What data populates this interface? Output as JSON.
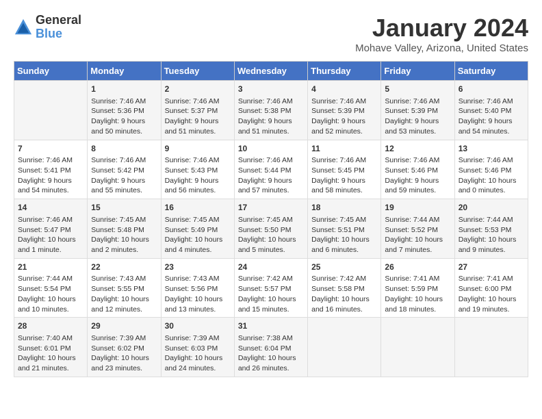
{
  "header": {
    "logo": {
      "general": "General",
      "blue": "Blue"
    },
    "title": "January 2024",
    "location": "Mohave Valley, Arizona, United States"
  },
  "calendar": {
    "headers": [
      "Sunday",
      "Monday",
      "Tuesday",
      "Wednesday",
      "Thursday",
      "Friday",
      "Saturday"
    ],
    "rows": [
      [
        {
          "day": "",
          "content": ""
        },
        {
          "day": "1",
          "content": "Sunrise: 7:46 AM\nSunset: 5:36 PM\nDaylight: 9 hours\nand 50 minutes."
        },
        {
          "day": "2",
          "content": "Sunrise: 7:46 AM\nSunset: 5:37 PM\nDaylight: 9 hours\nand 51 minutes."
        },
        {
          "day": "3",
          "content": "Sunrise: 7:46 AM\nSunset: 5:38 PM\nDaylight: 9 hours\nand 51 minutes."
        },
        {
          "day": "4",
          "content": "Sunrise: 7:46 AM\nSunset: 5:39 PM\nDaylight: 9 hours\nand 52 minutes."
        },
        {
          "day": "5",
          "content": "Sunrise: 7:46 AM\nSunset: 5:39 PM\nDaylight: 9 hours\nand 53 minutes."
        },
        {
          "day": "6",
          "content": "Sunrise: 7:46 AM\nSunset: 5:40 PM\nDaylight: 9 hours\nand 54 minutes."
        }
      ],
      [
        {
          "day": "7",
          "content": "Sunrise: 7:46 AM\nSunset: 5:41 PM\nDaylight: 9 hours\nand 54 minutes."
        },
        {
          "day": "8",
          "content": "Sunrise: 7:46 AM\nSunset: 5:42 PM\nDaylight: 9 hours\nand 55 minutes."
        },
        {
          "day": "9",
          "content": "Sunrise: 7:46 AM\nSunset: 5:43 PM\nDaylight: 9 hours\nand 56 minutes."
        },
        {
          "day": "10",
          "content": "Sunrise: 7:46 AM\nSunset: 5:44 PM\nDaylight: 9 hours\nand 57 minutes."
        },
        {
          "day": "11",
          "content": "Sunrise: 7:46 AM\nSunset: 5:45 PM\nDaylight: 9 hours\nand 58 minutes."
        },
        {
          "day": "12",
          "content": "Sunrise: 7:46 AM\nSunset: 5:46 PM\nDaylight: 9 hours\nand 59 minutes."
        },
        {
          "day": "13",
          "content": "Sunrise: 7:46 AM\nSunset: 5:46 PM\nDaylight: 10 hours\nand 0 minutes."
        }
      ],
      [
        {
          "day": "14",
          "content": "Sunrise: 7:46 AM\nSunset: 5:47 PM\nDaylight: 10 hours\nand 1 minute."
        },
        {
          "day": "15",
          "content": "Sunrise: 7:45 AM\nSunset: 5:48 PM\nDaylight: 10 hours\nand 2 minutes."
        },
        {
          "day": "16",
          "content": "Sunrise: 7:45 AM\nSunset: 5:49 PM\nDaylight: 10 hours\nand 4 minutes."
        },
        {
          "day": "17",
          "content": "Sunrise: 7:45 AM\nSunset: 5:50 PM\nDaylight: 10 hours\nand 5 minutes."
        },
        {
          "day": "18",
          "content": "Sunrise: 7:45 AM\nSunset: 5:51 PM\nDaylight: 10 hours\nand 6 minutes."
        },
        {
          "day": "19",
          "content": "Sunrise: 7:44 AM\nSunset: 5:52 PM\nDaylight: 10 hours\nand 7 minutes."
        },
        {
          "day": "20",
          "content": "Sunrise: 7:44 AM\nSunset: 5:53 PM\nDaylight: 10 hours\nand 9 minutes."
        }
      ],
      [
        {
          "day": "21",
          "content": "Sunrise: 7:44 AM\nSunset: 5:54 PM\nDaylight: 10 hours\nand 10 minutes."
        },
        {
          "day": "22",
          "content": "Sunrise: 7:43 AM\nSunset: 5:55 PM\nDaylight: 10 hours\nand 12 minutes."
        },
        {
          "day": "23",
          "content": "Sunrise: 7:43 AM\nSunset: 5:56 PM\nDaylight: 10 hours\nand 13 minutes."
        },
        {
          "day": "24",
          "content": "Sunrise: 7:42 AM\nSunset: 5:57 PM\nDaylight: 10 hours\nand 15 minutes."
        },
        {
          "day": "25",
          "content": "Sunrise: 7:42 AM\nSunset: 5:58 PM\nDaylight: 10 hours\nand 16 minutes."
        },
        {
          "day": "26",
          "content": "Sunrise: 7:41 AM\nSunset: 5:59 PM\nDaylight: 10 hours\nand 18 minutes."
        },
        {
          "day": "27",
          "content": "Sunrise: 7:41 AM\nSunset: 6:00 PM\nDaylight: 10 hours\nand 19 minutes."
        }
      ],
      [
        {
          "day": "28",
          "content": "Sunrise: 7:40 AM\nSunset: 6:01 PM\nDaylight: 10 hours\nand 21 minutes."
        },
        {
          "day": "29",
          "content": "Sunrise: 7:39 AM\nSunset: 6:02 PM\nDaylight: 10 hours\nand 23 minutes."
        },
        {
          "day": "30",
          "content": "Sunrise: 7:39 AM\nSunset: 6:03 PM\nDaylight: 10 hours\nand 24 minutes."
        },
        {
          "day": "31",
          "content": "Sunrise: 7:38 AM\nSunset: 6:04 PM\nDaylight: 10 hours\nand 26 minutes."
        },
        {
          "day": "",
          "content": ""
        },
        {
          "day": "",
          "content": ""
        },
        {
          "day": "",
          "content": ""
        }
      ]
    ]
  }
}
